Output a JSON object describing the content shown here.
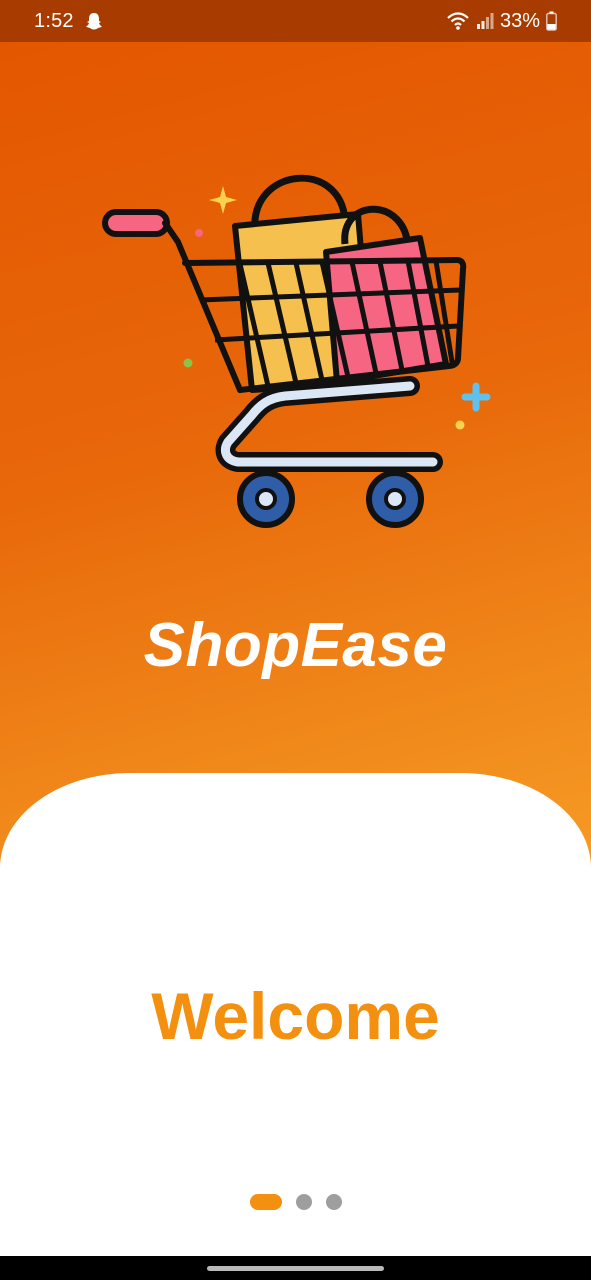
{
  "status_bar": {
    "time": "1:52",
    "battery_percent": "33%",
    "icons": [
      "snapchat-ghost-icon",
      "wifi-icon",
      "signal-icon",
      "battery-icon"
    ]
  },
  "hero": {
    "illustration": "shopping-cart-with-bags-icon",
    "colors": {
      "yellow_bag": "#f6c04f",
      "pink_bag": "#f66582",
      "handle": "#f66582",
      "wheels": "#2f5da8",
      "base": "#dce7f5"
    }
  },
  "brand": {
    "name": "ShopEase"
  },
  "card": {
    "title": "Welcome",
    "pager": {
      "total": 3,
      "active": 1
    }
  },
  "colors": {
    "accent": "#f4900f",
    "status_bar": "#a83c00",
    "dot_inactive": "#9e9e9e"
  }
}
